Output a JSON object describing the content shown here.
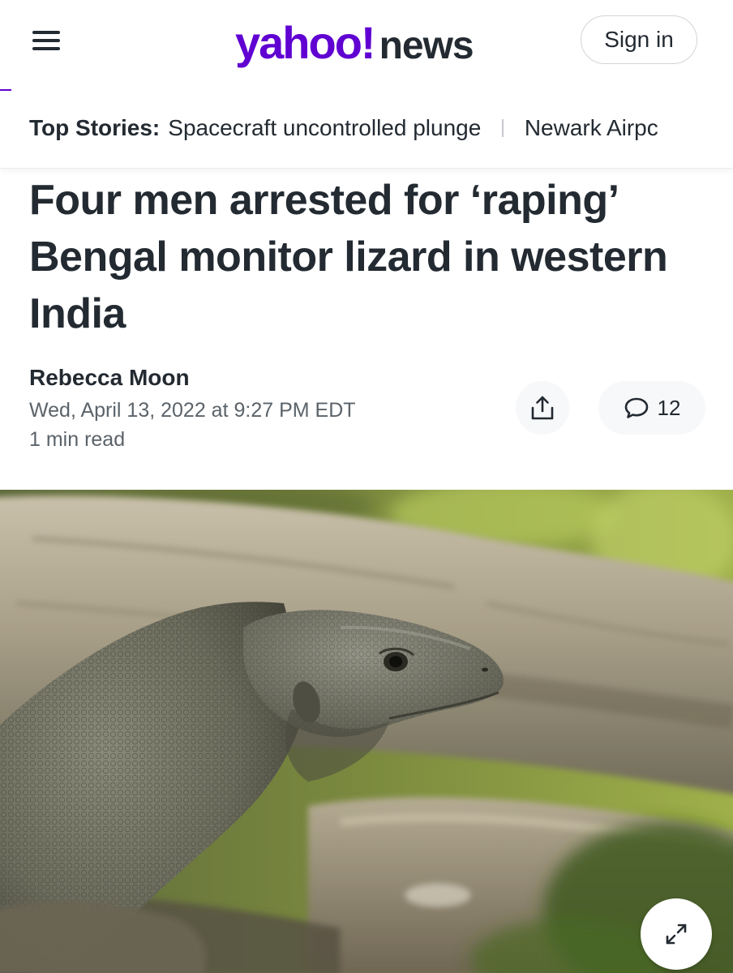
{
  "header": {
    "logo_primary": "yahoo!",
    "logo_secondary": "news",
    "sign_in_label": "Sign in",
    "brand_color": "#6001d2"
  },
  "top_stories": {
    "label": "Top Stories:",
    "items": [
      {
        "label": "Spacecraft uncontrolled plunge"
      },
      {
        "label": "Newark Airpc"
      }
    ]
  },
  "article": {
    "headline": "Four men arrested for ‘raping’ Bengal monitor lizard in western India",
    "author": "Rebecca Moon",
    "date": "Wed, April 13, 2022 at 9:27 PM EDT",
    "read_time": "1 min read",
    "comment_count": "12"
  },
  "icons": {
    "menu": "hamburger-menu-icon",
    "share": "share-icon",
    "comments": "comment-bubble-icon",
    "expand": "expand-arrows-icon"
  }
}
